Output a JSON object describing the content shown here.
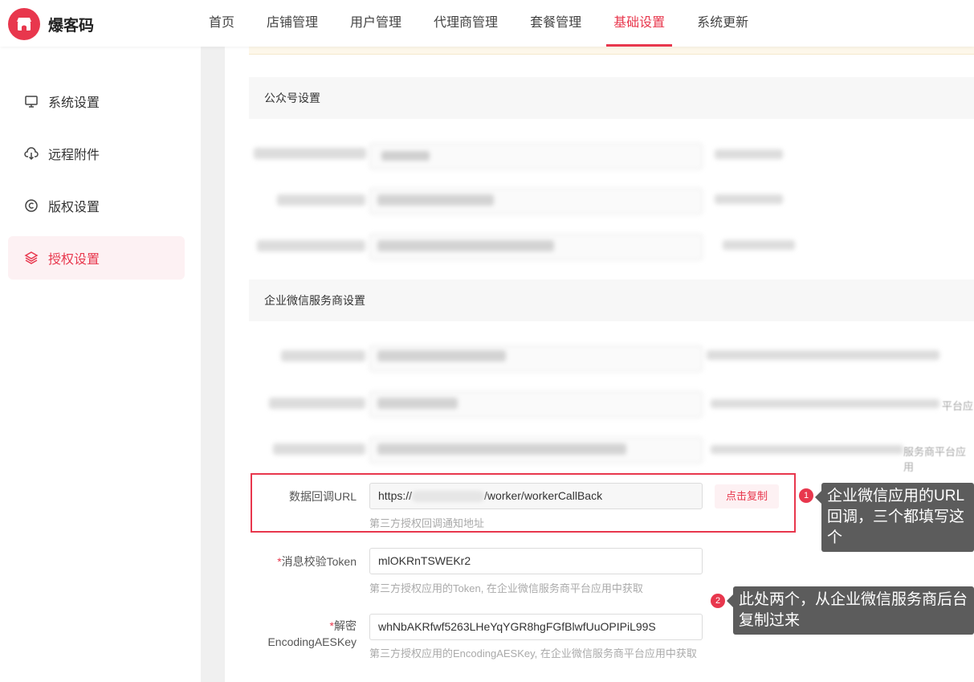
{
  "brand": {
    "name": "爆客码",
    "color": "#e8374d"
  },
  "nav": {
    "items": [
      {
        "label": "首页",
        "active": false
      },
      {
        "label": "店铺管理",
        "active": false
      },
      {
        "label": "用户管理",
        "active": false
      },
      {
        "label": "代理商管理",
        "active": false
      },
      {
        "label": "套餐管理",
        "active": false
      },
      {
        "label": "基础设置",
        "active": true
      },
      {
        "label": "系统更新",
        "active": false
      }
    ]
  },
  "sidebar": {
    "items": [
      {
        "label": "系统设置",
        "icon": "monitor-icon",
        "active": false
      },
      {
        "label": "远程附件",
        "icon": "cloud-download-icon",
        "active": false
      },
      {
        "label": "版权设置",
        "icon": "copyright-icon",
        "active": false
      },
      {
        "label": "授权设置",
        "icon": "layers-icon",
        "active": true
      }
    ]
  },
  "sections": {
    "official_account": "公众号设置",
    "wecom_provider": "企业微信服务商设置"
  },
  "form": {
    "callback_url": {
      "label": "数据回调URL",
      "value_prefix": "https://",
      "value_suffix": "/worker/workerCallBack",
      "copy_label": "点击复制",
      "hint": "第三方授权回调通知地址"
    },
    "token": {
      "required_mark": "*",
      "label": "消息校验Token",
      "value": "mlOKRnTSWEKr2",
      "hint": "第三方授权应用的Token, 在企业微信服务商平台应用中获取"
    },
    "aes_key": {
      "required_mark": "*",
      "label_line1": "解密",
      "label_line2": "EncodingAESKey",
      "value": "whNbAKRfwf5263LHeYqYGR8hgFGfBlwfUuOPIPiL99S",
      "hint": "第三方授权应用的EncodingAESKey, 在企业微信服务商平台应用中获取"
    }
  },
  "blurred_fragments": {
    "row5_suffix": "平台应",
    "row6_suffix": "服务商平台应用"
  },
  "annotations": [
    {
      "number": "1",
      "text": "企业微信应用的URL回调，三个都填写这个"
    },
    {
      "number": "2",
      "text": "此处两个，从企业微信服务商后台复制过来"
    }
  ]
}
